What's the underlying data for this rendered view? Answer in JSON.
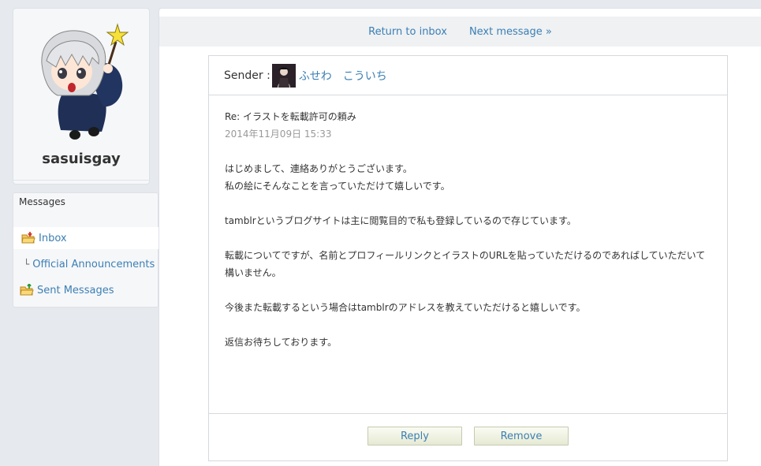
{
  "profile": {
    "username": "sasuisgay"
  },
  "messages_nav": {
    "title": "Messages",
    "items": [
      {
        "label": "Inbox",
        "icon": "folder-inbox-icon",
        "active": true
      },
      {
        "label": "Official Announcements",
        "icon": "branch",
        "active": false
      },
      {
        "label": "Sent Messages",
        "icon": "folder-sent-icon",
        "active": false
      }
    ]
  },
  "topnav": {
    "return_label": "Return to inbox",
    "next_label": "Next message »"
  },
  "message": {
    "sender_label": "Sender :",
    "sender_name": "ふせわ　こういち",
    "subject": "Re: イラストを転載許可の頼み",
    "date": "2014年11月09日 15:33",
    "body": [
      "はじめまして、連絡ありがとうございます。",
      "私の絵にそんなことを言っていただけて嬉しいです。",
      "tamblrというブログサイトは主に閲覧目的で私も登録しているので存じています。",
      "転載についてですが、名前とプロフィールリンクとイラストのURLを貼っていただけるのであればしていただいて",
      "構いません。",
      "今後また転載するという場合はtamblrのアドレスを教えていただけると嬉しいです。",
      "返信お待ちしております。"
    ]
  },
  "actions": {
    "reply_label": "Reply",
    "remove_label": "Remove"
  },
  "colors": {
    "link": "#3b7fb4",
    "page_bg": "#e6e9ee",
    "panel_bg": "#f6f7f9"
  }
}
